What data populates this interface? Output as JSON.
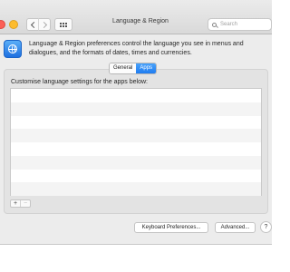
{
  "window": {
    "title": "Language & Region"
  },
  "toolbar": {
    "search_placeholder": "Search"
  },
  "header": {
    "description": "Language & Region preferences control the language you see in menus and dialogues, and the formats of dates, times and currencies."
  },
  "tabs": [
    {
      "label": "General",
      "active": false
    },
    {
      "label": "Apps",
      "active": true
    }
  ],
  "apps_panel": {
    "label": "Customise language settings for the apps below:",
    "add_symbol": "+",
    "remove_symbol": "−"
  },
  "buttons": {
    "keyboard_preferences": "Keyboard Preferences...",
    "advanced": "Advanced...",
    "help": "?"
  },
  "colors": {
    "accent": "#1f7cf0",
    "window_bg": "#ececec"
  },
  "icons": {
    "app_icon": "globe-icon"
  }
}
